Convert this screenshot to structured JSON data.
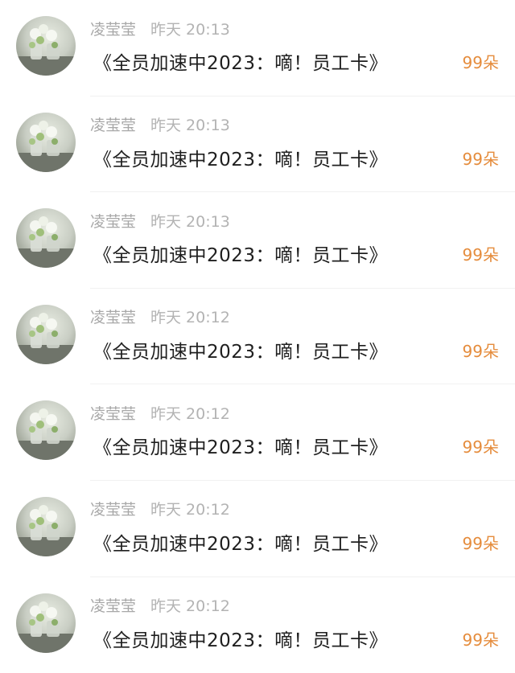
{
  "items": [
    {
      "name": "凌莹莹",
      "time": "昨天 20:13",
      "content": "《全员加速中2023：嘀！员工卡》",
      "reward": "99朵"
    },
    {
      "name": "凌莹莹",
      "time": "昨天 20:13",
      "content": "《全员加速中2023：嘀！员工卡》",
      "reward": "99朵"
    },
    {
      "name": "凌莹莹",
      "time": "昨天 20:13",
      "content": "《全员加速中2023：嘀！员工卡》",
      "reward": "99朵"
    },
    {
      "name": "凌莹莹",
      "time": "昨天 20:12",
      "content": "《全员加速中2023：嘀！员工卡》",
      "reward": "99朵"
    },
    {
      "name": "凌莹莹",
      "time": "昨天 20:12",
      "content": "《全员加速中2023：嘀！员工卡》",
      "reward": "99朵"
    },
    {
      "name": "凌莹莹",
      "time": "昨天 20:12",
      "content": "《全员加速中2023：嘀！员工卡》",
      "reward": "99朵"
    },
    {
      "name": "凌莹莹",
      "time": "昨天 20:12",
      "content": "《全员加速中2023：嘀！员工卡》",
      "reward": "99朵"
    }
  ],
  "colors": {
    "reward": "#e58c3c",
    "meta": "#a8a8a8",
    "content": "#1f1f1f"
  }
}
